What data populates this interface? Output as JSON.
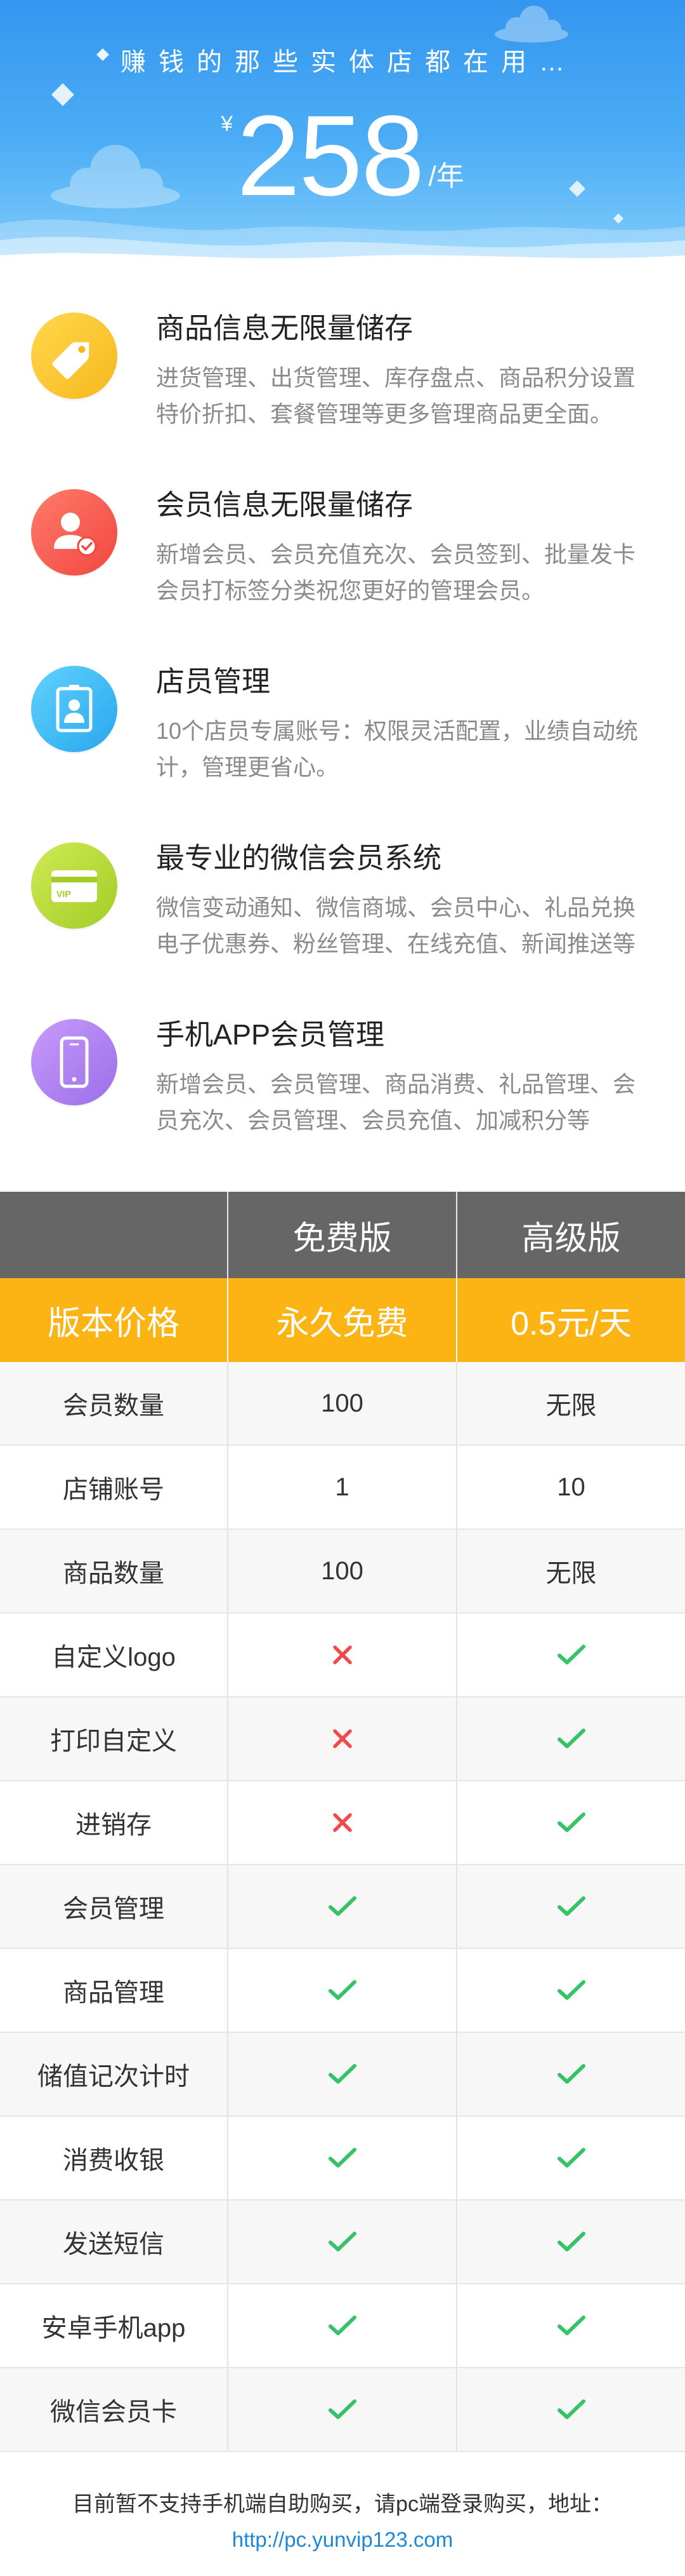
{
  "colors": {
    "banner_top": "#3496ef",
    "banner_bottom": "#86cffb",
    "text_primary": "#222222",
    "text_secondary": "#8a8a8a",
    "table_header_bg": "#666666",
    "price_row_bg": "#fbb414",
    "check": "#36c266",
    "cross": "#f04a4a",
    "link": "#1e88d8"
  },
  "banner": {
    "slogan": "赚钱的那些实体店都在用…",
    "price": {
      "currency": "¥",
      "amount": "258",
      "unit": "/年"
    }
  },
  "features": [
    {
      "icon": "tag-icon",
      "badge_color": [
        "#ffd84d",
        "#f6b81c"
      ],
      "title": "商品信息无限量储存",
      "desc_lines": [
        "进货管理、出货管理、库存盘点、商品积分设置",
        "特价折扣、套餐管理等更多管理商品更全面。"
      ]
    },
    {
      "icon": "member-icon",
      "badge_color": [
        "#ff7b6b",
        "#f0473f"
      ],
      "title": "会员信息无限量储存",
      "desc_lines": [
        "新增会员、会员充值充次、会员签到、批量发卡",
        "会员打标签分类祝您更好的管理会员。"
      ]
    },
    {
      "icon": "id-card-icon",
      "badge_color": [
        "#62d2fc",
        "#28a6ee"
      ],
      "title": "店员管理",
      "desc_lines": [
        "10个店员专属账号：权限灵活配置，业绩自动统",
        "计，管理更省心。"
      ]
    },
    {
      "icon": "vip-card-icon",
      "icon_label": "VIP",
      "badge_color": [
        "#cfea55",
        "#a3cc25"
      ],
      "title": "最专业的微信会员系统",
      "desc_lines": [
        "微信变动通知、微信商城、会员中心、礼品兑换",
        "电子优惠券、粉丝管理、在线充值、新闻推送等"
      ]
    },
    {
      "icon": "phone-icon",
      "badge_color": [
        "#c79cfb",
        "#9b6de8"
      ],
      "title": "手机APP会员管理",
      "desc_lines": [
        "新增会员、会员管理、商品消费、礼品管理、会",
        "员充次、会员管理、会员充值、加减积分等"
      ]
    }
  ],
  "pricing_table": {
    "plans": [
      "免费版",
      "高级版"
    ],
    "price_row": {
      "label": "版本价格",
      "values": [
        "永久免费",
        "0.5元/天"
      ]
    },
    "rows": [
      {
        "label": "会员数量",
        "cells": [
          {
            "text": "100"
          },
          {
            "text": "无限"
          }
        ]
      },
      {
        "label": "店铺账号",
        "cells": [
          {
            "text": "1"
          },
          {
            "text": "10"
          }
        ]
      },
      {
        "label": "商品数量",
        "cells": [
          {
            "text": "100"
          },
          {
            "text": "无限"
          }
        ]
      },
      {
        "label": "自定义logo",
        "cells": [
          {
            "icon": "cross-icon"
          },
          {
            "icon": "check-icon"
          }
        ]
      },
      {
        "label": "打印自定义",
        "cells": [
          {
            "icon": "cross-icon"
          },
          {
            "icon": "check-icon"
          }
        ]
      },
      {
        "label": "进销存",
        "cells": [
          {
            "icon": "cross-icon"
          },
          {
            "icon": "check-icon"
          }
        ]
      },
      {
        "label": "会员管理",
        "cells": [
          {
            "icon": "check-icon"
          },
          {
            "icon": "check-icon"
          }
        ]
      },
      {
        "label": "商品管理",
        "cells": [
          {
            "icon": "check-icon"
          },
          {
            "icon": "check-icon"
          }
        ]
      },
      {
        "label": "储值记次计时",
        "cells": [
          {
            "icon": "check-icon"
          },
          {
            "icon": "check-icon"
          }
        ]
      },
      {
        "label": "消费收银",
        "cells": [
          {
            "icon": "check-icon"
          },
          {
            "icon": "check-icon"
          }
        ]
      },
      {
        "label": "发送短信",
        "cells": [
          {
            "icon": "check-icon"
          },
          {
            "icon": "check-icon"
          }
        ]
      },
      {
        "label": "安卓手机app",
        "cells": [
          {
            "icon": "check-icon"
          },
          {
            "icon": "check-icon"
          }
        ]
      },
      {
        "label": "微信会员卡",
        "cells": [
          {
            "icon": "check-icon"
          },
          {
            "icon": "check-icon"
          }
        ]
      }
    ]
  },
  "footer": {
    "notice": "目前暂不支持手机端自助购买，请pc端登录购买，地址：",
    "link": "http://pc.yunvip123.com"
  }
}
